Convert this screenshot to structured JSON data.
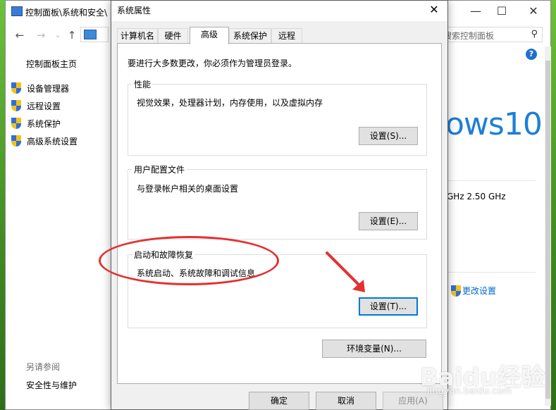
{
  "control_panel": {
    "title": "控制面板\\系统和安全\\",
    "search_placeholder": "搜索控制面板",
    "home_link": "控制面板主页",
    "sidebar_links": [
      "设备管理器",
      "远程设置",
      "系统保护",
      "高级系统设置"
    ],
    "see_also": "另请参阅",
    "security_link": "安全性与维护",
    "windows_brand": "ows10",
    "cpu_speed": "GHz   2.50 GHz",
    "change_settings": "更改设置"
  },
  "dialog": {
    "title": "系统属性",
    "tabs": [
      "计算机名",
      "硬件",
      "高级",
      "系统保护",
      "远程"
    ],
    "active_tab": "高级",
    "admin_note": "要进行大多数更改，你必须作为管理员登录。",
    "performance": {
      "label": "性能",
      "description": "视觉效果，处理器计划，内存使用，以及虚拟内存",
      "button": "设置(S)..."
    },
    "user_profiles": {
      "label": "用户配置文件",
      "description": "与登录帐户相关的桌面设置",
      "button": "设置(E)..."
    },
    "startup_recovery": {
      "label": "启动和故障恢复",
      "description": "系统启动、系统故障和调试信息",
      "button": "设置(T)..."
    },
    "env_vars_button": "环境变量(N)...",
    "ok_button": "确定",
    "cancel_button": "取消",
    "apply_button": "应用(A)"
  },
  "watermark": {
    "brand": "Baidu经验",
    "url": "jingyan.baidu.com"
  },
  "colors": {
    "annotation_red": "#e53030",
    "focus_blue": "#0078d7",
    "windows_blue": "#1e7fd6"
  }
}
